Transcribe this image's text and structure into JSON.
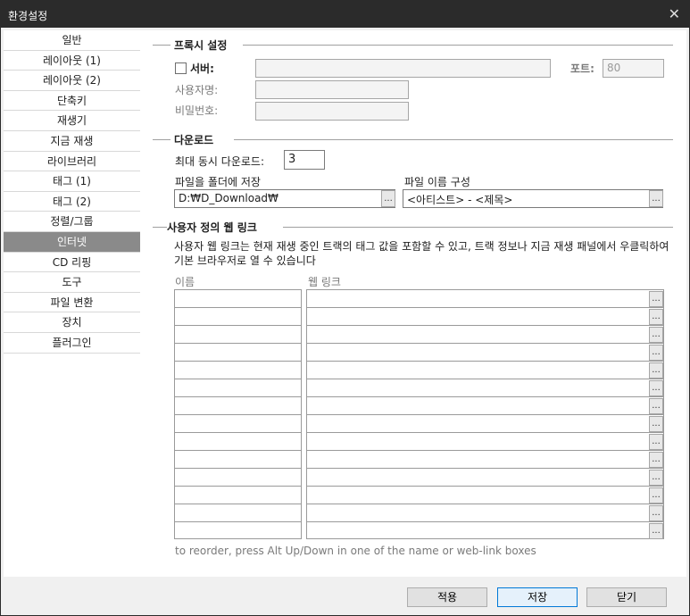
{
  "window": {
    "title": "환경설정",
    "close_glyph": "✕"
  },
  "sidebar": {
    "items": [
      {
        "label": "일반"
      },
      {
        "label": "레이아웃 (1)"
      },
      {
        "label": "레이아웃 (2)"
      },
      {
        "label": "단축키"
      },
      {
        "label": "재생기"
      },
      {
        "label": "지금 재생"
      },
      {
        "label": "라이브러리"
      },
      {
        "label": "태그 (1)"
      },
      {
        "label": "태그 (2)"
      },
      {
        "label": "정렬/그룹"
      },
      {
        "label": "인터넷"
      },
      {
        "label": "CD 리핑"
      },
      {
        "label": "도구"
      },
      {
        "label": "파일 변환"
      },
      {
        "label": "장치"
      },
      {
        "label": "플러그인"
      }
    ],
    "active_label": "인터넷"
  },
  "proxy": {
    "title": "프록시 설정",
    "server_label": "서버:",
    "server_value": "",
    "port_label": "포트:",
    "port_value": "80",
    "user_label": "사용자명:",
    "user_value": "",
    "password_label": "비밀번호:",
    "password_value": ""
  },
  "download": {
    "title": "다운로드",
    "max_label": "최대 동시 다운로드:",
    "max_value": "3",
    "folder_label": "파일을 폴더에 저장",
    "folder_value": "D:₩D_Download₩",
    "naming_label": "파일 이름 구성",
    "naming_value": "<아티스트> - <제목>",
    "ellipsis": "..."
  },
  "weblinks": {
    "title": "사용자 정의 웹 링크",
    "description": "사용자 웹 링크는 현재 재생 중인 트랙의 태그 값을 포함할 수 있고, 트랙 정보나 지금 재생 패널에서 우클릭하여 기본 브라우저로 열 수 있습니다",
    "name_header": "이름",
    "link_header": "웹 링크",
    "ellipsis": "...",
    "hint": "to reorder, press Alt Up/Down in one of the name or web-link boxes"
  },
  "footer": {
    "apply_label": "적용",
    "save_label": "저장",
    "close_label": "닫기"
  }
}
